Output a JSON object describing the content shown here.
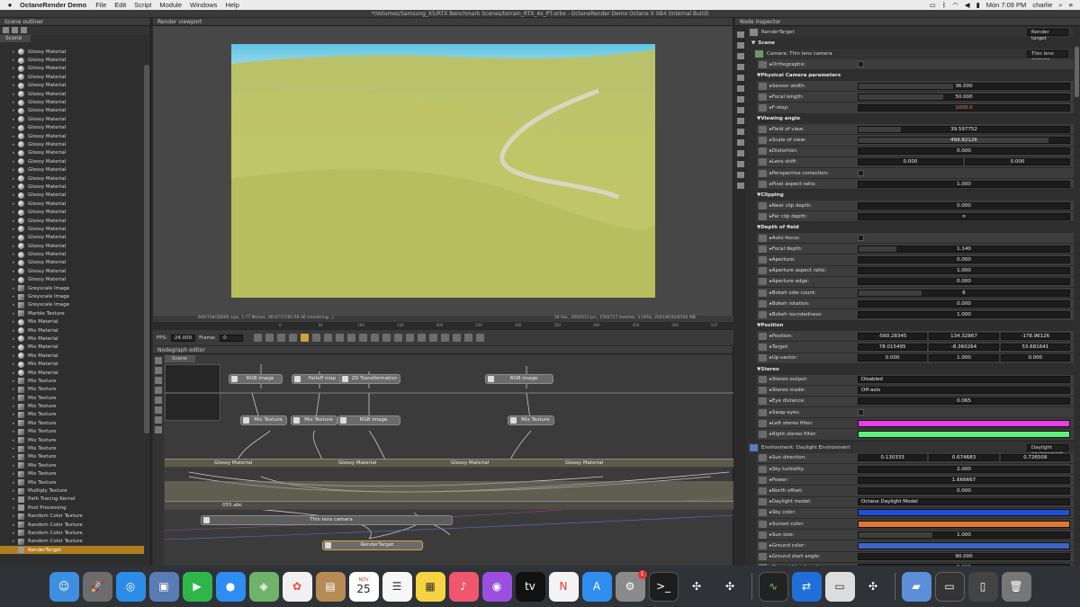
{
  "menubar": {
    "app": "OctaneRender Demo",
    "items": [
      "File",
      "Edit",
      "Script",
      "Module",
      "Windows",
      "Help"
    ],
    "clock": "Mon 7:09 PM",
    "user": "charlie"
  },
  "window": {
    "title": "*/Volumes/Samsung_X5/RTX Benchmark Scenes/terrain_RTX_4x_PT.orbx - OctaneRender Demo Octane X XB4 (Internal Build)"
  },
  "outliner": {
    "title": "Scene outliner",
    "tab": "Scene",
    "items": [
      {
        "label": "Glossy Material",
        "icon": "material-sphere-icon"
      },
      {
        "label": "Glossy Material",
        "icon": "material-sphere-icon"
      },
      {
        "label": "Glossy Material",
        "icon": "material-sphere-icon"
      },
      {
        "label": "Glossy Material",
        "icon": "material-sphere-icon"
      },
      {
        "label": "Glossy Material",
        "icon": "material-sphere-icon"
      },
      {
        "label": "Glossy Material",
        "icon": "material-sphere-icon"
      },
      {
        "label": "Glossy Material",
        "icon": "material-sphere-icon"
      },
      {
        "label": "Glossy Material",
        "icon": "material-sphere-icon"
      },
      {
        "label": "Glossy Material",
        "icon": "material-sphere-icon"
      },
      {
        "label": "Glossy Material",
        "icon": "material-sphere-icon"
      },
      {
        "label": "Glossy Material",
        "icon": "material-sphere-icon"
      },
      {
        "label": "Glossy Material",
        "icon": "material-sphere-icon"
      },
      {
        "label": "Glossy Material",
        "icon": "material-sphere-icon"
      },
      {
        "label": "Glossy Material",
        "icon": "material-sphere-icon"
      },
      {
        "label": "Glossy Material",
        "icon": "material-sphere-icon"
      },
      {
        "label": "Glossy Material",
        "icon": "material-sphere-icon"
      },
      {
        "label": "Glossy Material",
        "icon": "material-sphere-icon"
      },
      {
        "label": "Glossy Material",
        "icon": "material-sphere-icon"
      },
      {
        "label": "Glossy Material",
        "icon": "material-sphere-icon"
      },
      {
        "label": "Glossy Material",
        "icon": "material-sphere-icon"
      },
      {
        "label": "Glossy Material",
        "icon": "material-sphere-icon"
      },
      {
        "label": "Glossy Material",
        "icon": "material-sphere-icon"
      },
      {
        "label": "Glossy Material",
        "icon": "material-sphere-icon"
      },
      {
        "label": "Glossy Material",
        "icon": "material-sphere-icon"
      },
      {
        "label": "Glossy Material",
        "icon": "material-sphere-icon"
      },
      {
        "label": "Glossy Material",
        "icon": "material-sphere-icon"
      },
      {
        "label": "Glossy Material",
        "icon": "material-sphere-icon"
      },
      {
        "label": "Glossy Material",
        "icon": "material-sphere-icon"
      },
      {
        "label": "Greyscale Image",
        "icon": "texture-icon"
      },
      {
        "label": "Greyscale Image",
        "icon": "texture-icon"
      },
      {
        "label": "Greyscale Image",
        "icon": "texture-icon"
      },
      {
        "label": "Marble Texture",
        "icon": "texture-icon"
      },
      {
        "label": "Mix Material",
        "icon": "material-sphere-icon"
      },
      {
        "label": "Mix Material",
        "icon": "material-sphere-icon"
      },
      {
        "label": "Mix Material",
        "icon": "material-sphere-icon"
      },
      {
        "label": "Mix Material",
        "icon": "material-sphere-icon"
      },
      {
        "label": "Mix Material",
        "icon": "material-sphere-icon"
      },
      {
        "label": "Mix Material",
        "icon": "material-sphere-icon"
      },
      {
        "label": "Mix Material",
        "icon": "material-sphere-icon"
      },
      {
        "label": "Mix Texture",
        "icon": "texture-icon"
      },
      {
        "label": "Mix Texture",
        "icon": "texture-icon"
      },
      {
        "label": "Mix Texture",
        "icon": "texture-icon"
      },
      {
        "label": "Mix Texture",
        "icon": "texture-icon"
      },
      {
        "label": "Mix Texture",
        "icon": "texture-icon"
      },
      {
        "label": "Mix Texture",
        "icon": "texture-icon"
      },
      {
        "label": "Mix Texture",
        "icon": "texture-icon"
      },
      {
        "label": "Mix Texture",
        "icon": "texture-icon"
      },
      {
        "label": "Mix Texture",
        "icon": "texture-icon"
      },
      {
        "label": "Mix Texture",
        "icon": "texture-icon"
      },
      {
        "label": "Mix Texture",
        "icon": "texture-icon"
      },
      {
        "label": "Mix Texture",
        "icon": "texture-icon"
      },
      {
        "label": "Mix Texture",
        "icon": "texture-icon"
      },
      {
        "label": "Multiply Texture",
        "icon": "texture-icon"
      },
      {
        "label": "Path Tracing Kernel",
        "icon": "kernel-icon"
      },
      {
        "label": "Post Processing",
        "icon": "kernel-icon"
      },
      {
        "label": "Random Color Texture",
        "icon": "texture-icon"
      },
      {
        "label": "Random Color Texture",
        "icon": "texture-icon"
      },
      {
        "label": "Random Color Texture",
        "icon": "texture-icon"
      },
      {
        "label": "Random Color Texture",
        "icon": "texture-icon"
      },
      {
        "label": "RenderTarget",
        "icon": "kernel-icon",
        "selected": true
      }
    ]
  },
  "viewport": {
    "title": "Render viewport",
    "status_left": "640/704/20000 s/px, 1.77 Ms/sec, 00:07:17/01:56:36 (rendering...)",
    "status_right": "34 tex., 4592513 pri., 1502717 meshes, 3 GPUs, 2541/8192/8192 MB",
    "ruler": [
      "0",
      "50",
      "100",
      "150",
      "200",
      "250",
      "300",
      "350",
      "400",
      "450",
      "500",
      "537"
    ],
    "fps_label": "FPS:",
    "fps": "24.000",
    "frame_label": "Frame:",
    "frame": "0"
  },
  "nodegraph": {
    "title": "Nodegraph editor",
    "tab": "Scene",
    "nodes": {
      "rgb1": "RGB image",
      "falloff": "Falloff map",
      "transform2d": "2D Transformation",
      "rgb2": "RGB image",
      "mix1": "Mix Texture",
      "mix2": "Mix Texture",
      "rgb3": "RGB image",
      "mix3": "Mix Texture",
      "glossy1": "Glossy Material",
      "glossy2": "Glossy Material",
      "glossy3": "Glossy Material",
      "glossy4": "Glossy Material",
      "abc": "055.abc",
      "camera": "Thin lens camera",
      "rendertarget": "RenderTarget"
    }
  },
  "inspector": {
    "title": "Node inspector",
    "node": "RenderTarget",
    "node_type": "Render target",
    "scene_label": "Scene",
    "camera": {
      "label": "Camera: Thin lens camera",
      "type": "Thin lens camera"
    },
    "rows": [
      {
        "k": "param",
        "name": "Orthographic:",
        "kind": "check"
      },
      {
        "k": "sec",
        "name": "Physical Camera parameters"
      },
      {
        "k": "param",
        "name": "Sensor width:",
        "kind": "num",
        "values": [
          "36.000"
        ],
        "fill": 0.45
      },
      {
        "k": "param",
        "name": "Focal length:",
        "kind": "num",
        "values": [
          "50.000"
        ],
        "fill": 0.4
      },
      {
        "k": "param",
        "name": "F-stop:",
        "kind": "num",
        "values": [
          "1000.0"
        ],
        "fill": 0,
        "accent": "#e8807c"
      },
      {
        "k": "sec",
        "name": "Viewing angle"
      },
      {
        "k": "param",
        "name": "Field of view:",
        "kind": "num",
        "values": [
          "39.597752"
        ],
        "fill": 0.2
      },
      {
        "k": "param",
        "name": "Scale of view:",
        "kind": "num",
        "values": [
          "499.82126"
        ],
        "fill": 0.9
      },
      {
        "k": "param",
        "name": "Distortion:",
        "kind": "num",
        "values": [
          "0.000"
        ],
        "fill": 0
      },
      {
        "k": "param",
        "name": "Lens shift:",
        "kind": "num",
        "values": [
          "0.000",
          "0.000"
        ],
        "fill": 0
      },
      {
        "k": "param",
        "name": "Perspective correction:",
        "kind": "check"
      },
      {
        "k": "param",
        "name": "Pixel aspect ratio:",
        "kind": "num",
        "values": [
          "1.000"
        ],
        "fill": 0
      },
      {
        "k": "sec",
        "name": "Clipping"
      },
      {
        "k": "param",
        "name": "Near clip depth:",
        "kind": "num",
        "values": [
          "0.000"
        ],
        "fill": 0
      },
      {
        "k": "param",
        "name": "Far clip depth:",
        "kind": "num",
        "values": [
          "∞"
        ],
        "fill": 0
      },
      {
        "k": "sec",
        "name": "Depth of field"
      },
      {
        "k": "param",
        "name": "Auto-focus:",
        "kind": "check"
      },
      {
        "k": "param",
        "name": "Focal depth:",
        "kind": "num",
        "values": [
          "1.140"
        ],
        "fill": 0.18
      },
      {
        "k": "param",
        "name": "Aperture:",
        "kind": "num",
        "values": [
          "0.000"
        ],
        "fill": 0
      },
      {
        "k": "param",
        "name": "Aperture aspect ratio:",
        "kind": "num",
        "values": [
          "1.000"
        ],
        "fill": 0
      },
      {
        "k": "param",
        "name": "Aperture edge:",
        "kind": "num",
        "values": [
          "0.000"
        ],
        "fill": 0
      },
      {
        "k": "param",
        "name": "Bokeh side count:",
        "kind": "num",
        "values": [
          "6"
        ],
        "fill": 0.3
      },
      {
        "k": "param",
        "name": "Bokeh rotation:",
        "kind": "num",
        "values": [
          "0.000"
        ],
        "fill": 0
      },
      {
        "k": "param",
        "name": "Bokeh roundedness:",
        "kind": "num",
        "values": [
          "1.000"
        ],
        "fill": 0
      },
      {
        "k": "sec",
        "name": "Position"
      },
      {
        "k": "param",
        "name": "Position:",
        "kind": "num",
        "values": [
          "-560.28345",
          "134.32867",
          "-178.96126"
        ],
        "fill": 0
      },
      {
        "k": "param",
        "name": "Target:",
        "kind": "num",
        "values": [
          "78.015495",
          "-8.360264",
          "53.681641"
        ],
        "fill": 0
      },
      {
        "k": "param",
        "name": "Up-vector:",
        "kind": "num",
        "values": [
          "0.000",
          "1.000",
          "0.000"
        ],
        "fill": 0
      },
      {
        "k": "sec",
        "name": "Stereo"
      },
      {
        "k": "param",
        "name": "Stereo output:",
        "kind": "select",
        "values": [
          "Disabled"
        ]
      },
      {
        "k": "param",
        "name": "Stereo mode:",
        "kind": "select",
        "values": [
          "Off-axis"
        ]
      },
      {
        "k": "param",
        "name": "Eye distance:",
        "kind": "num",
        "values": [
          "0.065"
        ],
        "fill": 0
      },
      {
        "k": "param",
        "name": "Swap eyes:",
        "kind": "check"
      },
      {
        "k": "param",
        "name": "Left stereo filter:",
        "kind": "color",
        "color": "#e83ee8"
      },
      {
        "k": "param",
        "name": "Right stereo filter:",
        "kind": "color",
        "color": "#5ef07a"
      },
      {
        "k": "head",
        "name": "Environment: Daylight Environment",
        "type": "Daylight environment"
      },
      {
        "k": "param",
        "name": "Sun direction:",
        "kind": "num",
        "values": [
          "0.130333",
          "0.674683",
          "0.726509"
        ],
        "fill": 0
      },
      {
        "k": "param",
        "name": "Sky turbidity:",
        "kind": "num",
        "values": [
          "2.000"
        ],
        "fill": 0
      },
      {
        "k": "param",
        "name": "Power:",
        "kind": "num",
        "values": [
          "1.666667"
        ],
        "fill": 0
      },
      {
        "k": "param",
        "name": "North offset:",
        "kind": "num",
        "values": [
          "0.000"
        ],
        "fill": 0
      },
      {
        "k": "param",
        "name": "Daylight model:",
        "kind": "select",
        "values": [
          "Octane Daylight Model"
        ]
      },
      {
        "k": "param",
        "name": "Sky color:",
        "kind": "color",
        "color": "#1f4fd6"
      },
      {
        "k": "param",
        "name": "Sunset color:",
        "kind": "color",
        "color": "#e0782f"
      },
      {
        "k": "param",
        "name": "Sun size:",
        "kind": "num",
        "values": [
          "1.000"
        ],
        "fill": 0.35
      },
      {
        "k": "param",
        "name": "Ground color:",
        "kind": "color",
        "color": "#3d64c8"
      },
      {
        "k": "param",
        "name": "Ground start angle:",
        "kind": "num",
        "values": [
          "90.000"
        ],
        "fill": 0
      },
      {
        "k": "param",
        "name": "Ground blend angle:",
        "kind": "num",
        "values": [
          "5.000"
        ],
        "fill": 0
      }
    ]
  },
  "dock": {
    "calendar_month": "NOV",
    "calendar_day": "25",
    "badge": "1"
  },
  "colors": {
    "accent": "#c9a33c",
    "selection": "#b07d1e"
  }
}
